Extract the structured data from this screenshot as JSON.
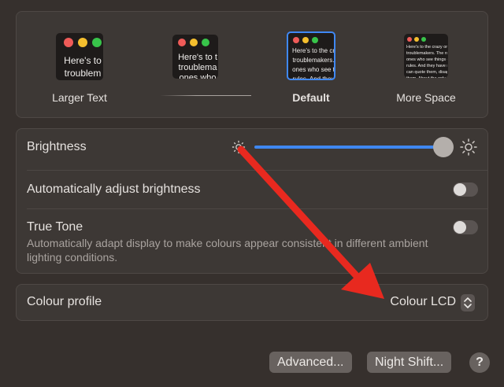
{
  "scale": {
    "options": [
      {
        "label": "Larger Text",
        "sample": "Here's to\ntroublem"
      },
      {
        "label": "",
        "sample": "Here's to t\ntroublema\nones who"
      },
      {
        "label": "Default",
        "sample": "Here's to the cr\ntroublemakers.\nones who see t\nrules. And they"
      },
      {
        "label": "More Space",
        "sample": "Here's to the crazy ones\ntroublemakers. The rou\nones who see things dif\nrules. And they have no\ncan quote them, disagre\nthem. About the only th\nBecause they change th"
      }
    ]
  },
  "display": {
    "brightness_label": "Brightness",
    "brightness_level": 0.92,
    "auto_brightness_label": "Automatically adjust brightness",
    "auto_brightness_on": false,
    "true_tone_label": "True Tone",
    "true_tone_desc": "Automatically adapt display to make colours appear consistent in different ambient lighting conditions.",
    "true_tone_on": false
  },
  "profile": {
    "label": "Colour profile",
    "value": "Colour LCD"
  },
  "buttons": {
    "advanced": "Advanced...",
    "night_shift": "Night Shift...",
    "help": "?"
  },
  "icons": {
    "brightness_low": "sun-small-icon",
    "brightness_high": "sun-large-icon",
    "stepper": "up-down-chevron-icon"
  },
  "colors": {
    "accent": "#3f87f0",
    "annotation_arrow": "#e8291f",
    "selected_border": "#3f88f5"
  }
}
